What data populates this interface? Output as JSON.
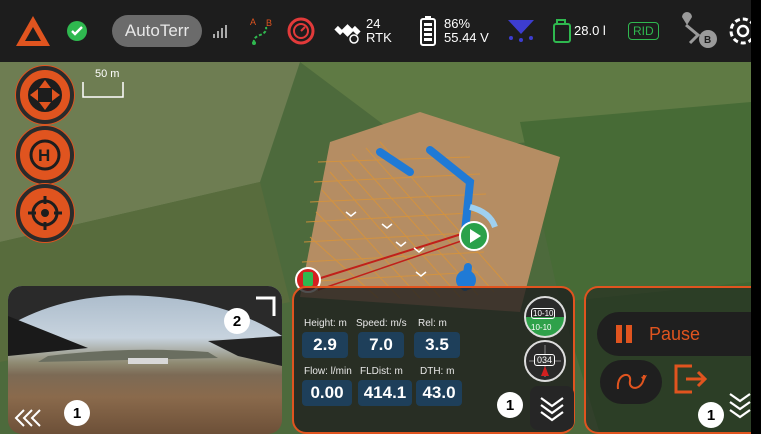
{
  "topbar": {
    "mode_label": "AutoTerr",
    "satellites": "24",
    "fix_type": "RTK",
    "battery_percent": "86%",
    "battery_voltage": "55.44 V",
    "tank_level": "28.0 l",
    "rid_label": "RID"
  },
  "map": {
    "scale_label": "50 m"
  },
  "telemetry": {
    "height_label": "Height: m",
    "height_value": "2.9",
    "speed_label": "Speed: m/s",
    "speed_value": "7.0",
    "rel_label": "Rel: m",
    "rel_value": "3.5",
    "flow_label": "Flow: l/min",
    "flow_value": "0.00",
    "fldist_label": "FLDist: m",
    "fldist_value": "414.1",
    "dth_label": "DTH: m",
    "dth_value": "43.0",
    "attitude_top": "10-10",
    "attitude_bottom": "10-10",
    "heading": "034"
  },
  "controls": {
    "pause_label": "Pause"
  },
  "badges": {
    "camera_badge": "1",
    "camera_corner_badge": "2",
    "telemetry_badge": "1",
    "controls_badge": "1"
  },
  "colors": {
    "accent": "#e0541f",
    "ok_green": "#2fb84f",
    "mission_blue": "#1f7ad6"
  }
}
